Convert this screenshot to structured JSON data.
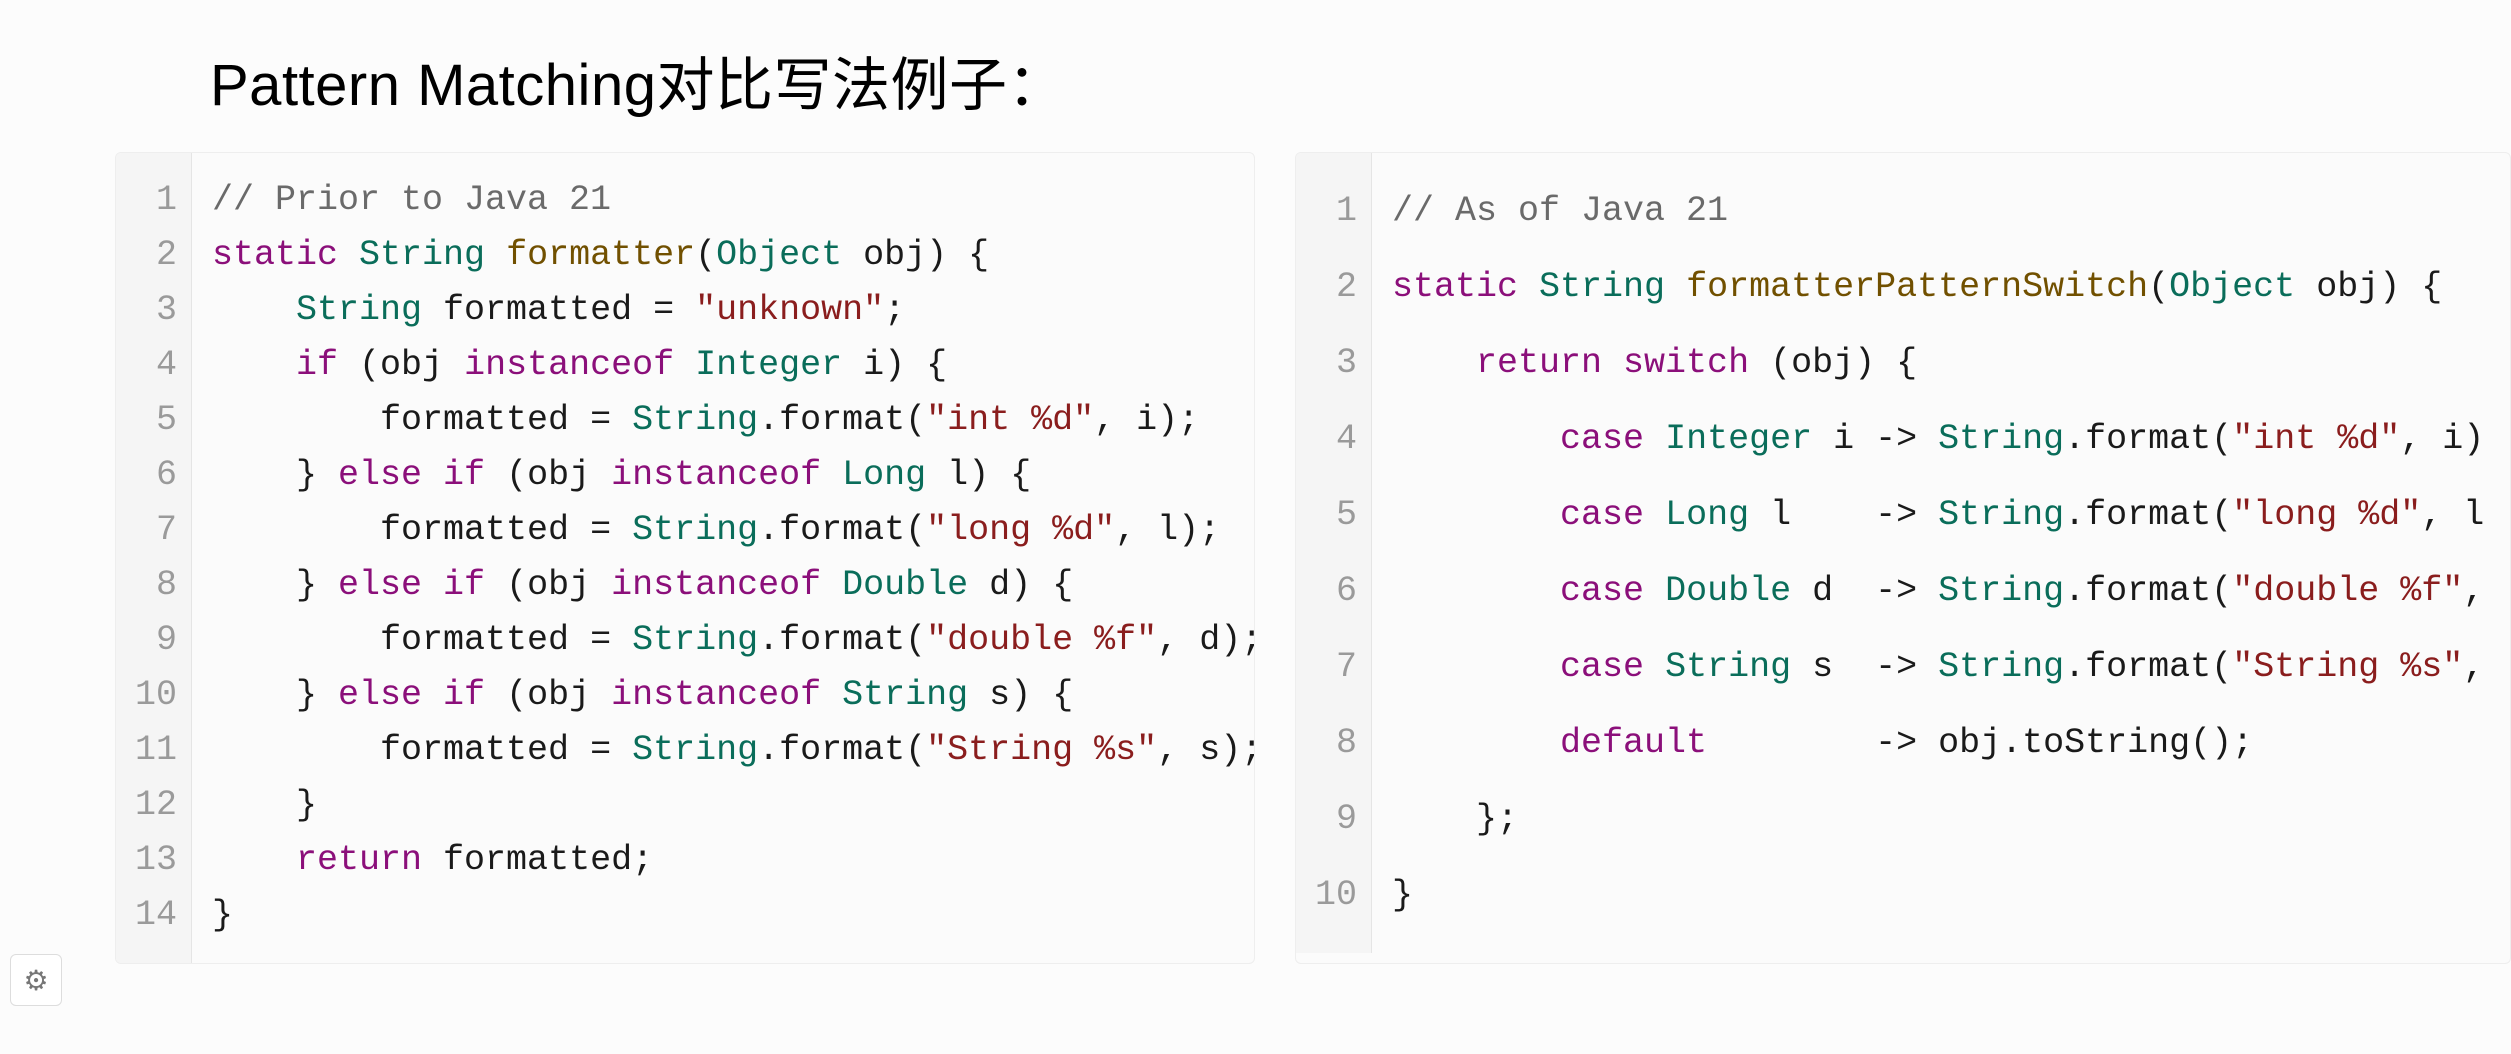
{
  "heading": "Pattern Matching对比写法例子：",
  "gear_icon": "⚙",
  "left_code": {
    "comment": "// Prior to Java 21",
    "lines": [
      {
        "n": 1,
        "segs": [
          {
            "t": "// Prior to Java 21",
            "c": "cm"
          }
        ]
      },
      {
        "n": 2,
        "segs": [
          {
            "t": "static ",
            "c": "kw"
          },
          {
            "t": "String ",
            "c": "ty"
          },
          {
            "t": "formatter",
            "c": "fn"
          },
          {
            "t": "(",
            "c": "pn"
          },
          {
            "t": "Object ",
            "c": "ty"
          },
          {
            "t": "obj",
            "c": "id"
          },
          {
            "t": ") {",
            "c": "pn"
          }
        ]
      },
      {
        "n": 3,
        "segs": [
          {
            "t": "    ",
            "c": "pn"
          },
          {
            "t": "String ",
            "c": "ty"
          },
          {
            "t": "formatted ",
            "c": "id"
          },
          {
            "t": "= ",
            "c": "pn"
          },
          {
            "t": "\"unknown\"",
            "c": "str"
          },
          {
            "t": ";",
            "c": "pn"
          }
        ]
      },
      {
        "n": 4,
        "segs": [
          {
            "t": "    ",
            "c": "pn"
          },
          {
            "t": "if ",
            "c": "kw"
          },
          {
            "t": "(obj ",
            "c": "id"
          },
          {
            "t": "instanceof ",
            "c": "kw"
          },
          {
            "t": "Integer ",
            "c": "ty"
          },
          {
            "t": "i",
            "c": "id"
          },
          {
            "t": ") {",
            "c": "pn"
          }
        ]
      },
      {
        "n": 5,
        "segs": [
          {
            "t": "        formatted ",
            "c": "id"
          },
          {
            "t": "= ",
            "c": "pn"
          },
          {
            "t": "String",
            "c": "ty"
          },
          {
            "t": ".format(",
            "c": "pn"
          },
          {
            "t": "\"int %d\"",
            "c": "str"
          },
          {
            "t": ", i);",
            "c": "pn"
          }
        ]
      },
      {
        "n": 6,
        "segs": [
          {
            "t": "    } ",
            "c": "pn"
          },
          {
            "t": "else if ",
            "c": "kw"
          },
          {
            "t": "(obj ",
            "c": "id"
          },
          {
            "t": "instanceof ",
            "c": "kw"
          },
          {
            "t": "Long ",
            "c": "ty"
          },
          {
            "t": "l",
            "c": "id"
          },
          {
            "t": ") {",
            "c": "pn"
          }
        ]
      },
      {
        "n": 7,
        "segs": [
          {
            "t": "        formatted ",
            "c": "id"
          },
          {
            "t": "= ",
            "c": "pn"
          },
          {
            "t": "String",
            "c": "ty"
          },
          {
            "t": ".format(",
            "c": "pn"
          },
          {
            "t": "\"long %d\"",
            "c": "str"
          },
          {
            "t": ", l);",
            "c": "pn"
          }
        ]
      },
      {
        "n": 8,
        "segs": [
          {
            "t": "    } ",
            "c": "pn"
          },
          {
            "t": "else if ",
            "c": "kw"
          },
          {
            "t": "(obj ",
            "c": "id"
          },
          {
            "t": "instanceof ",
            "c": "kw"
          },
          {
            "t": "Double ",
            "c": "ty"
          },
          {
            "t": "d",
            "c": "id"
          },
          {
            "t": ") {",
            "c": "pn"
          }
        ]
      },
      {
        "n": 9,
        "segs": [
          {
            "t": "        formatted ",
            "c": "id"
          },
          {
            "t": "= ",
            "c": "pn"
          },
          {
            "t": "String",
            "c": "ty"
          },
          {
            "t": ".format(",
            "c": "pn"
          },
          {
            "t": "\"double %f\"",
            "c": "str"
          },
          {
            "t": ", d);",
            "c": "pn"
          }
        ]
      },
      {
        "n": 10,
        "segs": [
          {
            "t": "    } ",
            "c": "pn"
          },
          {
            "t": "else if ",
            "c": "kw"
          },
          {
            "t": "(obj ",
            "c": "id"
          },
          {
            "t": "instanceof ",
            "c": "kw"
          },
          {
            "t": "String ",
            "c": "ty"
          },
          {
            "t": "s",
            "c": "id"
          },
          {
            "t": ") {",
            "c": "pn"
          }
        ]
      },
      {
        "n": 11,
        "segs": [
          {
            "t": "        formatted ",
            "c": "id"
          },
          {
            "t": "= ",
            "c": "pn"
          },
          {
            "t": "String",
            "c": "ty"
          },
          {
            "t": ".format(",
            "c": "pn"
          },
          {
            "t": "\"String %s\"",
            "c": "str"
          },
          {
            "t": ", s);",
            "c": "pn"
          }
        ]
      },
      {
        "n": 12,
        "segs": [
          {
            "t": "    }",
            "c": "pn"
          }
        ]
      },
      {
        "n": 13,
        "segs": [
          {
            "t": "    ",
            "c": "pn"
          },
          {
            "t": "return ",
            "c": "kw"
          },
          {
            "t": "formatted;",
            "c": "id"
          }
        ]
      },
      {
        "n": 14,
        "segs": [
          {
            "t": "}",
            "c": "pn"
          }
        ]
      }
    ]
  },
  "right_code": {
    "comment": "// As of Java 21",
    "lines": [
      {
        "n": 1,
        "segs": [
          {
            "t": "// As of Java 21",
            "c": "cm"
          }
        ]
      },
      {
        "n": 2,
        "segs": [
          {
            "t": "static ",
            "c": "kw"
          },
          {
            "t": "String ",
            "c": "ty"
          },
          {
            "t": "formatterPatternSwitch",
            "c": "fn"
          },
          {
            "t": "(",
            "c": "pn"
          },
          {
            "t": "Object ",
            "c": "ty"
          },
          {
            "t": "obj",
            "c": "id"
          },
          {
            "t": ") {",
            "c": "pn"
          }
        ]
      },
      {
        "n": 3,
        "segs": [
          {
            "t": "    ",
            "c": "pn"
          },
          {
            "t": "return ",
            "c": "kw"
          },
          {
            "t": "switch ",
            "c": "kw"
          },
          {
            "t": "(obj) {",
            "c": "pn"
          }
        ]
      },
      {
        "n": 4,
        "segs": [
          {
            "t": "        ",
            "c": "pn"
          },
          {
            "t": "case ",
            "c": "kw"
          },
          {
            "t": "Integer ",
            "c": "ty"
          },
          {
            "t": "i ",
            "c": "id"
          },
          {
            "t": "-> ",
            "c": "pn"
          },
          {
            "t": "String",
            "c": "ty"
          },
          {
            "t": ".format(",
            "c": "pn"
          },
          {
            "t": "\"int %d\"",
            "c": "str"
          },
          {
            "t": ", i)",
            "c": "pn"
          }
        ]
      },
      {
        "n": 5,
        "segs": [
          {
            "t": "        ",
            "c": "pn"
          },
          {
            "t": "case ",
            "c": "kw"
          },
          {
            "t": "Long ",
            "c": "ty"
          },
          {
            "t": "l    ",
            "c": "id"
          },
          {
            "t": "-> ",
            "c": "pn"
          },
          {
            "t": "String",
            "c": "ty"
          },
          {
            "t": ".format(",
            "c": "pn"
          },
          {
            "t": "\"long %d\"",
            "c": "str"
          },
          {
            "t": ", l",
            "c": "pn"
          }
        ]
      },
      {
        "n": 6,
        "segs": [
          {
            "t": "        ",
            "c": "pn"
          },
          {
            "t": "case ",
            "c": "kw"
          },
          {
            "t": "Double ",
            "c": "ty"
          },
          {
            "t": "d  ",
            "c": "id"
          },
          {
            "t": "-> ",
            "c": "pn"
          },
          {
            "t": "String",
            "c": "ty"
          },
          {
            "t": ".format(",
            "c": "pn"
          },
          {
            "t": "\"double %f\"",
            "c": "str"
          },
          {
            "t": ",",
            "c": "pn"
          }
        ]
      },
      {
        "n": 7,
        "segs": [
          {
            "t": "        ",
            "c": "pn"
          },
          {
            "t": "case ",
            "c": "kw"
          },
          {
            "t": "String ",
            "c": "ty"
          },
          {
            "t": "s  ",
            "c": "id"
          },
          {
            "t": "-> ",
            "c": "pn"
          },
          {
            "t": "String",
            "c": "ty"
          },
          {
            "t": ".format(",
            "c": "pn"
          },
          {
            "t": "\"String %s\"",
            "c": "str"
          },
          {
            "t": ",",
            "c": "pn"
          }
        ]
      },
      {
        "n": 8,
        "segs": [
          {
            "t": "        ",
            "c": "pn"
          },
          {
            "t": "default        ",
            "c": "kw"
          },
          {
            "t": "-> obj.toString();",
            "c": "pn"
          }
        ]
      },
      {
        "n": 9,
        "segs": [
          {
            "t": "    };",
            "c": "pn"
          }
        ]
      },
      {
        "n": 10,
        "segs": [
          {
            "t": "}",
            "c": "pn"
          }
        ]
      }
    ]
  }
}
